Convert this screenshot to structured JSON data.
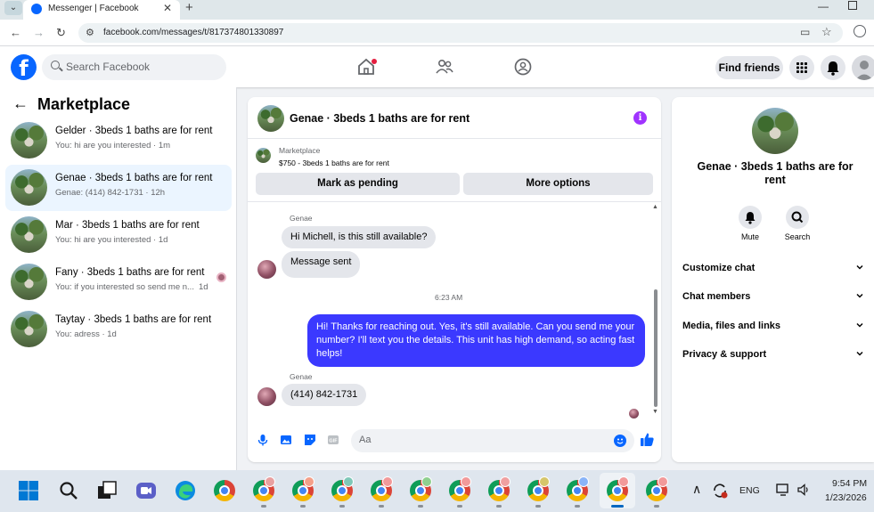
{
  "browser": {
    "tab_title": "Messenger | Facebook",
    "url": "facebook.com/messages/t/817374801330897"
  },
  "fb_nav": {
    "search_placeholder": "Search Facebook",
    "find_friends_label": "Find friends"
  },
  "left_panel": {
    "title": "Marketplace",
    "conversations": [
      {
        "name": "Gelder · 3beds 1 baths are for rent",
        "preview": "You: hi are you interested · 1m",
        "time": "",
        "active": false
      },
      {
        "name": "Genae · 3beds 1 baths are for rent",
        "preview": "Genae: (414) 842-1731 · 12h",
        "time": "",
        "active": true
      },
      {
        "name": "Mar · 3beds 1 baths are for rent",
        "preview": "You: hi are you interested · 1d",
        "time": "",
        "active": false
      },
      {
        "name": "Fany · 3beds 1 baths are for rent",
        "preview": "You: if you interested so send me n...",
        "time": "1d",
        "active": false
      },
      {
        "name": "Taytay · 3beds 1 baths are for rent",
        "preview": "You: adress · 1d",
        "time": "",
        "active": false
      }
    ]
  },
  "chat": {
    "title": "Genae · 3beds 1 baths are for rent",
    "listing_source": "Marketplace",
    "listing_price": "$750 - 3beds 1 baths are for rent",
    "mark_pending_label": "Mark as pending",
    "more_options_label": "More options",
    "sender_name_1": "Genae",
    "message_1": "Hi Michell, is this still available?",
    "message_2": "Message sent",
    "timestamp": "6:23 AM",
    "outgoing_message": "Hi! Thanks for reaching out. Yes, it's still available. Can you send me your number? I'll text you the details. This unit has high demand, so acting fast helps!",
    "sender_name_2": "Genae",
    "message_3": "(414) 842-1731",
    "composer_placeholder": "Aa"
  },
  "right_panel": {
    "title": "Genae · 3beds 1 baths are for rent",
    "mute_label": "Mute",
    "search_label": "Search",
    "sections": [
      "Customize chat",
      "Chat members",
      "Media, files and links",
      "Privacy & support"
    ]
  },
  "taskbar": {
    "language": "ENG",
    "time": "9:54 PM",
    "date": "1/23/2026"
  },
  "colors": {
    "fb_blue": "#0866ff",
    "outgoing_bubble": "#3b39ff",
    "info_purple": "#a033ff"
  }
}
